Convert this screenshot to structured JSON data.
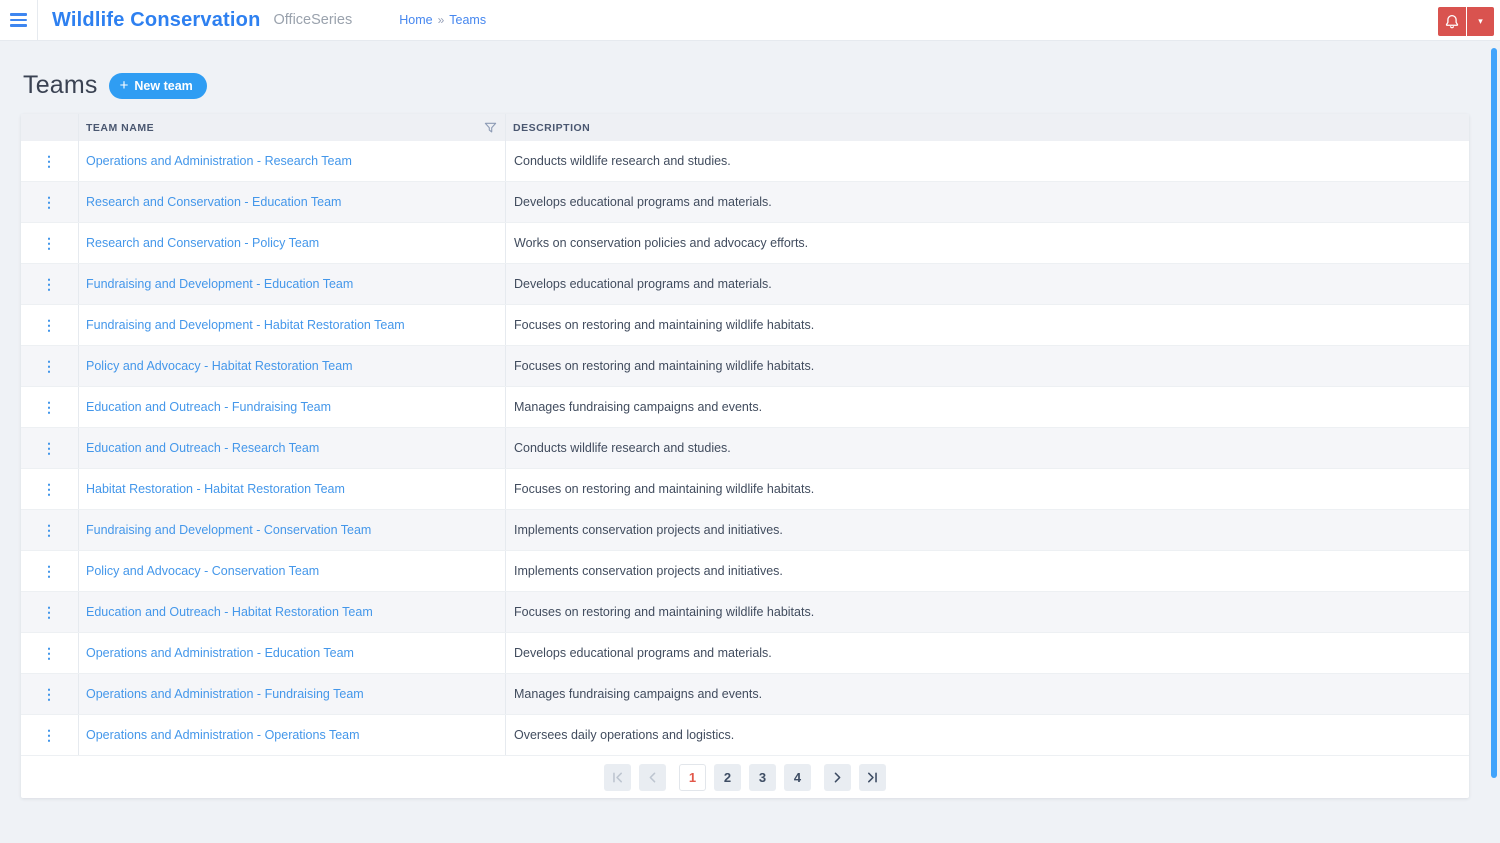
{
  "header": {
    "app_title": "Wildlife Conservation",
    "suite_name": "OfficeSeries",
    "breadcrumb": {
      "home": "Home",
      "separator": "»",
      "current": "Teams"
    }
  },
  "page": {
    "title": "Teams",
    "new_team_button": {
      "plus_glyph": "+",
      "label": "New team"
    }
  },
  "icons": {
    "kebab_glyph": "⋮",
    "caret_glyph": "▾"
  },
  "table": {
    "columns": {
      "team_name": "TEAM NAME",
      "description": "DESCRIPTION"
    },
    "rows": [
      {
        "name": "Operations and Administration - Research Team",
        "description": "Conducts wildlife research and studies."
      },
      {
        "name": "Research and Conservation - Education Team",
        "description": "Develops educational programs and materials."
      },
      {
        "name": "Research and Conservation - Policy Team",
        "description": "Works on conservation policies and advocacy efforts."
      },
      {
        "name": "Fundraising and Development - Education Team",
        "description": "Develops educational programs and materials."
      },
      {
        "name": "Fundraising and Development - Habitat Restoration Team",
        "description": "Focuses on restoring and maintaining wildlife habitats."
      },
      {
        "name": "Policy and Advocacy - Habitat Restoration Team",
        "description": "Focuses on restoring and maintaining wildlife habitats."
      },
      {
        "name": "Education and Outreach - Fundraising Team",
        "description": "Manages fundraising campaigns and events."
      },
      {
        "name": "Education and Outreach - Research Team",
        "description": "Conducts wildlife research and studies."
      },
      {
        "name": "Habitat Restoration - Habitat Restoration Team",
        "description": "Focuses on restoring and maintaining wildlife habitats."
      },
      {
        "name": "Fundraising and Development - Conservation Team",
        "description": "Implements conservation projects and initiatives."
      },
      {
        "name": "Policy and Advocacy - Conservation Team",
        "description": "Implements conservation projects and initiatives."
      },
      {
        "name": "Education and Outreach - Habitat Restoration Team",
        "description": "Focuses on restoring and maintaining wildlife habitats."
      },
      {
        "name": "Operations and Administration - Education Team",
        "description": "Develops educational programs and materials."
      },
      {
        "name": "Operations and Administration - Fundraising Team",
        "description": "Manages fundraising campaigns and events."
      },
      {
        "name": "Operations and Administration - Operations Team",
        "description": "Oversees daily operations and logistics."
      }
    ]
  },
  "pagination": {
    "pages": [
      "1",
      "2",
      "3",
      "4"
    ],
    "active": "1",
    "disabled": [
      "first",
      "prev"
    ]
  },
  "colors": {
    "brand-blue": "#2e80f0",
    "link-blue": "#4497ea",
    "button-blue": "#2f9df3",
    "danger-red": "#d9534f",
    "active-page-red": "#e25749",
    "scrollbar-blue": "#41a4fb"
  }
}
